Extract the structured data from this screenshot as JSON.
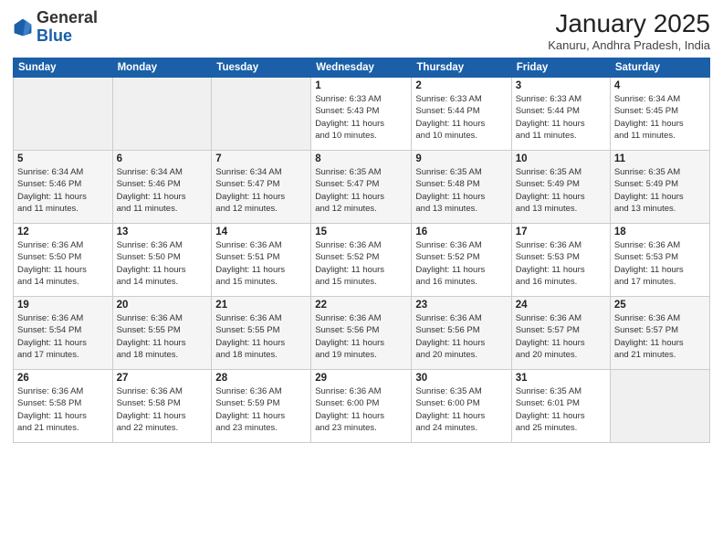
{
  "header": {
    "logo_general": "General",
    "logo_blue": "Blue",
    "month_title": "January 2025",
    "location": "Kanuru, Andhra Pradesh, India"
  },
  "days_of_week": [
    "Sunday",
    "Monday",
    "Tuesday",
    "Wednesday",
    "Thursday",
    "Friday",
    "Saturday"
  ],
  "weeks": [
    [
      {
        "num": "",
        "info": ""
      },
      {
        "num": "",
        "info": ""
      },
      {
        "num": "",
        "info": ""
      },
      {
        "num": "1",
        "info": "Sunrise: 6:33 AM\nSunset: 5:43 PM\nDaylight: 11 hours\nand 10 minutes."
      },
      {
        "num": "2",
        "info": "Sunrise: 6:33 AM\nSunset: 5:44 PM\nDaylight: 11 hours\nand 10 minutes."
      },
      {
        "num": "3",
        "info": "Sunrise: 6:33 AM\nSunset: 5:44 PM\nDaylight: 11 hours\nand 11 minutes."
      },
      {
        "num": "4",
        "info": "Sunrise: 6:34 AM\nSunset: 5:45 PM\nDaylight: 11 hours\nand 11 minutes."
      }
    ],
    [
      {
        "num": "5",
        "info": "Sunrise: 6:34 AM\nSunset: 5:46 PM\nDaylight: 11 hours\nand 11 minutes."
      },
      {
        "num": "6",
        "info": "Sunrise: 6:34 AM\nSunset: 5:46 PM\nDaylight: 11 hours\nand 11 minutes."
      },
      {
        "num": "7",
        "info": "Sunrise: 6:34 AM\nSunset: 5:47 PM\nDaylight: 11 hours\nand 12 minutes."
      },
      {
        "num": "8",
        "info": "Sunrise: 6:35 AM\nSunset: 5:47 PM\nDaylight: 11 hours\nand 12 minutes."
      },
      {
        "num": "9",
        "info": "Sunrise: 6:35 AM\nSunset: 5:48 PM\nDaylight: 11 hours\nand 13 minutes."
      },
      {
        "num": "10",
        "info": "Sunrise: 6:35 AM\nSunset: 5:49 PM\nDaylight: 11 hours\nand 13 minutes."
      },
      {
        "num": "11",
        "info": "Sunrise: 6:35 AM\nSunset: 5:49 PM\nDaylight: 11 hours\nand 13 minutes."
      }
    ],
    [
      {
        "num": "12",
        "info": "Sunrise: 6:36 AM\nSunset: 5:50 PM\nDaylight: 11 hours\nand 14 minutes."
      },
      {
        "num": "13",
        "info": "Sunrise: 6:36 AM\nSunset: 5:50 PM\nDaylight: 11 hours\nand 14 minutes."
      },
      {
        "num": "14",
        "info": "Sunrise: 6:36 AM\nSunset: 5:51 PM\nDaylight: 11 hours\nand 15 minutes."
      },
      {
        "num": "15",
        "info": "Sunrise: 6:36 AM\nSunset: 5:52 PM\nDaylight: 11 hours\nand 15 minutes."
      },
      {
        "num": "16",
        "info": "Sunrise: 6:36 AM\nSunset: 5:52 PM\nDaylight: 11 hours\nand 16 minutes."
      },
      {
        "num": "17",
        "info": "Sunrise: 6:36 AM\nSunset: 5:53 PM\nDaylight: 11 hours\nand 16 minutes."
      },
      {
        "num": "18",
        "info": "Sunrise: 6:36 AM\nSunset: 5:53 PM\nDaylight: 11 hours\nand 17 minutes."
      }
    ],
    [
      {
        "num": "19",
        "info": "Sunrise: 6:36 AM\nSunset: 5:54 PM\nDaylight: 11 hours\nand 17 minutes."
      },
      {
        "num": "20",
        "info": "Sunrise: 6:36 AM\nSunset: 5:55 PM\nDaylight: 11 hours\nand 18 minutes."
      },
      {
        "num": "21",
        "info": "Sunrise: 6:36 AM\nSunset: 5:55 PM\nDaylight: 11 hours\nand 18 minutes."
      },
      {
        "num": "22",
        "info": "Sunrise: 6:36 AM\nSunset: 5:56 PM\nDaylight: 11 hours\nand 19 minutes."
      },
      {
        "num": "23",
        "info": "Sunrise: 6:36 AM\nSunset: 5:56 PM\nDaylight: 11 hours\nand 20 minutes."
      },
      {
        "num": "24",
        "info": "Sunrise: 6:36 AM\nSunset: 5:57 PM\nDaylight: 11 hours\nand 20 minutes."
      },
      {
        "num": "25",
        "info": "Sunrise: 6:36 AM\nSunset: 5:57 PM\nDaylight: 11 hours\nand 21 minutes."
      }
    ],
    [
      {
        "num": "26",
        "info": "Sunrise: 6:36 AM\nSunset: 5:58 PM\nDaylight: 11 hours\nand 21 minutes."
      },
      {
        "num": "27",
        "info": "Sunrise: 6:36 AM\nSunset: 5:58 PM\nDaylight: 11 hours\nand 22 minutes."
      },
      {
        "num": "28",
        "info": "Sunrise: 6:36 AM\nSunset: 5:59 PM\nDaylight: 11 hours\nand 23 minutes."
      },
      {
        "num": "29",
        "info": "Sunrise: 6:36 AM\nSunset: 6:00 PM\nDaylight: 11 hours\nand 23 minutes."
      },
      {
        "num": "30",
        "info": "Sunrise: 6:35 AM\nSunset: 6:00 PM\nDaylight: 11 hours\nand 24 minutes."
      },
      {
        "num": "31",
        "info": "Sunrise: 6:35 AM\nSunset: 6:01 PM\nDaylight: 11 hours\nand 25 minutes."
      },
      {
        "num": "",
        "info": ""
      }
    ]
  ]
}
